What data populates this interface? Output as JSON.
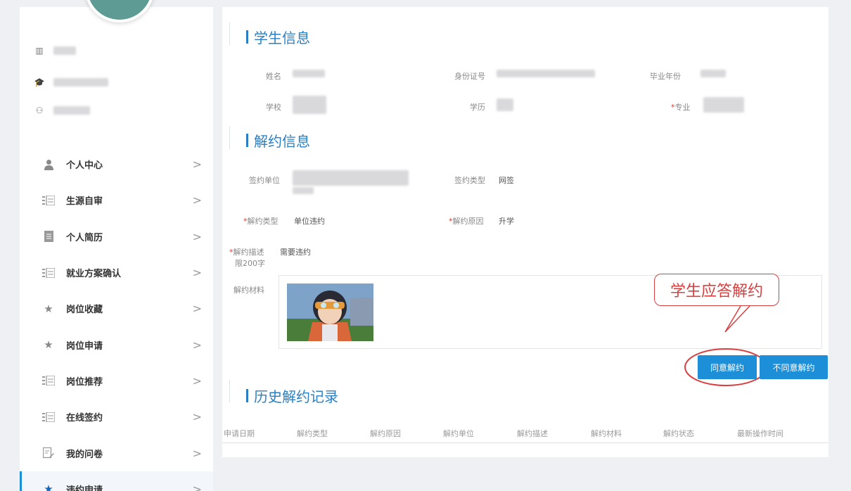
{
  "sidebar": {
    "menu": [
      {
        "label": "个人中心",
        "icon": "person-icon"
      },
      {
        "label": "生源自审",
        "icon": "list-icon"
      },
      {
        "label": "个人简历",
        "icon": "document-icon"
      },
      {
        "label": "就业方案确认",
        "icon": "list-icon"
      },
      {
        "label": "岗位收藏",
        "icon": "star-icon"
      },
      {
        "label": "岗位申请",
        "icon": "star-icon"
      },
      {
        "label": "岗位推荐",
        "icon": "list-icon"
      },
      {
        "label": "在线签约",
        "icon": "list-icon"
      },
      {
        "label": "我的问卷",
        "icon": "edit-icon"
      },
      {
        "label": "违约申请",
        "icon": "star-icon"
      }
    ],
    "chevron": ">"
  },
  "student_info": {
    "title": "学生信息",
    "name_label": "姓名",
    "id_label": "身份证号",
    "grad_year_label": "毕业年份",
    "school_label": "学校",
    "degree_label": "学历",
    "major_label": "专业",
    "required_mark": "*"
  },
  "cancel_info": {
    "title": "解约信息",
    "unit_label": "签约单位",
    "sign_type_label": "签约类型",
    "sign_type_value": "网签",
    "cancel_type_label": "解约类型",
    "cancel_type_value": "单位违约",
    "reason_label": "解约原因",
    "reason_value": "升学",
    "desc_label": "解约描述",
    "desc_limit": "限200字",
    "desc_value": "需要违约",
    "material_label": "解约材料"
  },
  "actions": {
    "agree_label": "同意解约",
    "disagree_label": "不同意解约",
    "callout_text": "学生应答解约"
  },
  "history": {
    "title": "历史解约记录",
    "columns": [
      "申请日期",
      "解约类型",
      "解约原因",
      "解约单位",
      "解约描述",
      "解约材料",
      "解约状态",
      "最新操作时间"
    ]
  },
  "colors": {
    "accent": "#1d8ed8",
    "title": "#2a7fc4",
    "annotation": "#d84040"
  }
}
